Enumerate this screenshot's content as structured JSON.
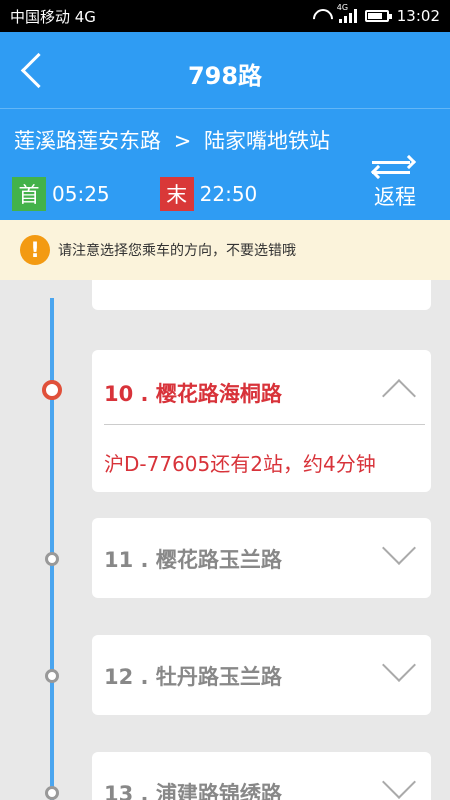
{
  "status_bar": {
    "carrier": "中国移动 4G",
    "network": "4G",
    "time": "13:02"
  },
  "header": {
    "title": "798路"
  },
  "route": {
    "from": "莲溪路莲安东路",
    "arrow": ">",
    "to": "陆家嘴地铁站",
    "first_label": "首",
    "first_time": "05:25",
    "last_label": "末",
    "last_time": "22:50",
    "return_label": "返程"
  },
  "notice": {
    "icon": "!",
    "text": "请注意选择您乘车的方向，不要选错哦"
  },
  "stations": [
    {
      "name": "10 . 樱花路海桐路",
      "active": true,
      "info": "沪D-77605还有2站，约4分钟"
    },
    {
      "name": "11 . 樱花路玉兰路",
      "active": false
    },
    {
      "name": "12 . 牡丹路玉兰路",
      "active": false
    },
    {
      "name": "13 . 浦建路锦绣路",
      "active": false
    }
  ],
  "colors": {
    "header_blue": "#2f9cf3",
    "active_red": "#d8333a",
    "first_green": "#43b24a",
    "last_red": "#d93838",
    "notice_orange": "#f39a12"
  }
}
